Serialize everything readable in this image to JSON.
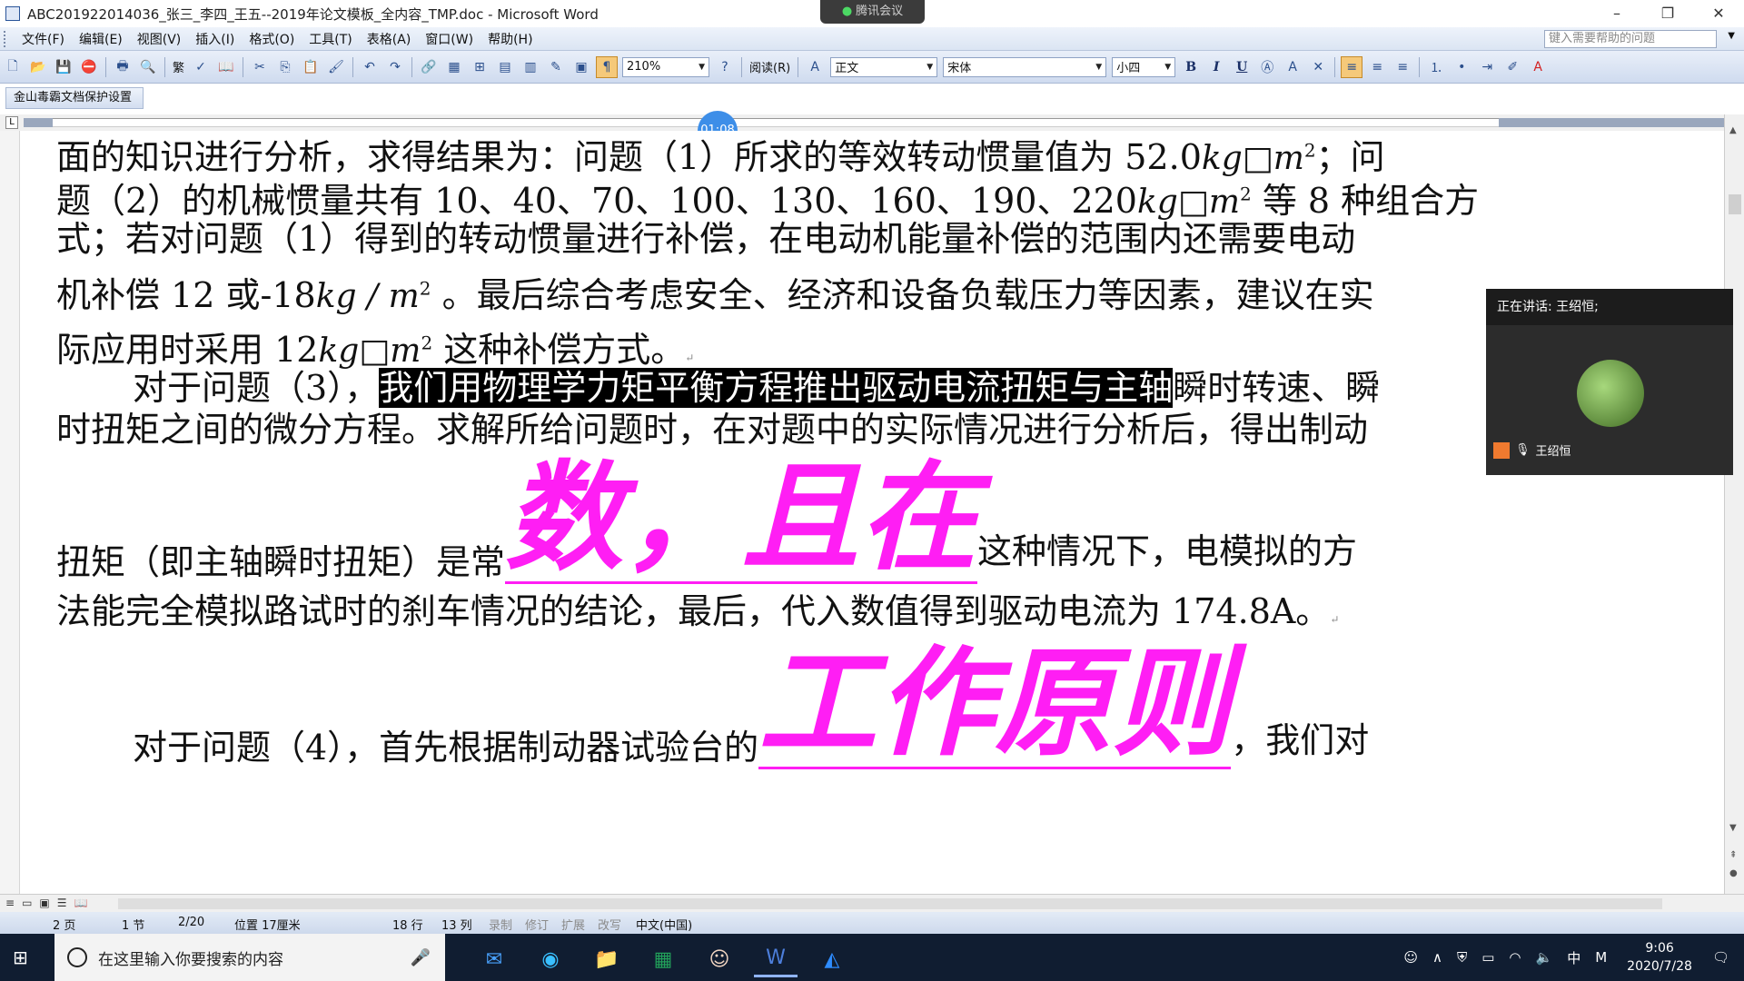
{
  "window": {
    "title": "ABC201922014036_张三_李四_王五--2019年论文模板_全内容_TMP.doc - Microsoft Word",
    "minimize": "–",
    "restore": "❐",
    "close": "✕"
  },
  "meeting_pill": "腾讯会议",
  "menu": {
    "items": [
      "文件(F)",
      "编辑(E)",
      "视图(V)",
      "插入(I)",
      "格式(O)",
      "工具(T)",
      "表格(A)",
      "窗口(W)",
      "帮助(H)"
    ],
    "help_placeholder": "键入需要帮助的问题"
  },
  "toolbar": {
    "traditional_label": "繁",
    "zoom": "210%",
    "read_label": "阅读(R)",
    "style": "正文",
    "font": "宋体",
    "size": "小四",
    "bold": "B",
    "italic": "I",
    "underline": "U"
  },
  "security_toolbar": {
    "label": "金山毒霸文档保护设置"
  },
  "timer": "01:08",
  "document": {
    "l1_text": "面的知识进行分析，求得结果为：问题（1）所求的等效转动惯量值为 52.0",
    "l1_end": "；问",
    "l2_text": "题（2）的机械惯量共有 10、40、70、100、130、160、190、220",
    "l2_end": "等 8 种组合方",
    "l3_text": "式；若对问题（1）得到的转动惯量进行补偿，在电动机能量补偿的范围内还需要电动",
    "l4_text": "机补偿 12 或-18",
    "l4_unit": "kg / m",
    "l4_end": "。最后综合考虑安全、经济和设备负载压力等因素，建议在实",
    "l5_text": "际应用时采用 12",
    "l5_end": "这种补偿方式。",
    "l6_start": "对于问题（3），",
    "l6_highlight": "我们用物理学力矩平衡方程推出驱动电流扭矩与主轴",
    "l6_end": "瞬时转速、瞬",
    "l7_text": "时扭矩之间的微分方程。求解所给问题时，在对题中的实际情况进行分析后，得出制动",
    "l8_start": "扭矩（即主轴瞬时扭矩）是常",
    "l8_big": "数，且在",
    "l8_end": "这种情况下，电模拟的方",
    "l9_text": "法能完全模拟路试时的刹车情况的结论，最后，代入数值得到驱动电流为 174.8A。",
    "l10_start": "对于问题（4），首先根据制动器试验台的",
    "l10_big": "工作原则",
    "l10_end": "，我们对",
    "unit_kg_m": "kg□m",
    "sup2": "2",
    "para_mark": "↵"
  },
  "meeting": {
    "speaking": "正在讲话: 王绍恒;",
    "participant": "王绍恒"
  },
  "status": {
    "page": "2 页",
    "section": "1 节",
    "page_of": "2/20",
    "position": "位置 17厘米",
    "line": "18 行",
    "column": "13 列",
    "rec": "录制",
    "trk": "修订",
    "ext": "扩展",
    "ovr": "改写",
    "lang": "中文(中国)"
  },
  "taskbar": {
    "search_placeholder": "在这里输入你要搜索的内容",
    "ime": "中",
    "ime2": "M",
    "time": "9:06",
    "date": "2020/7/28"
  },
  "colors": {
    "accent_magenta": "#ff1ef4",
    "taskbar": "#101d31",
    "timer": "#3d8ee8"
  }
}
